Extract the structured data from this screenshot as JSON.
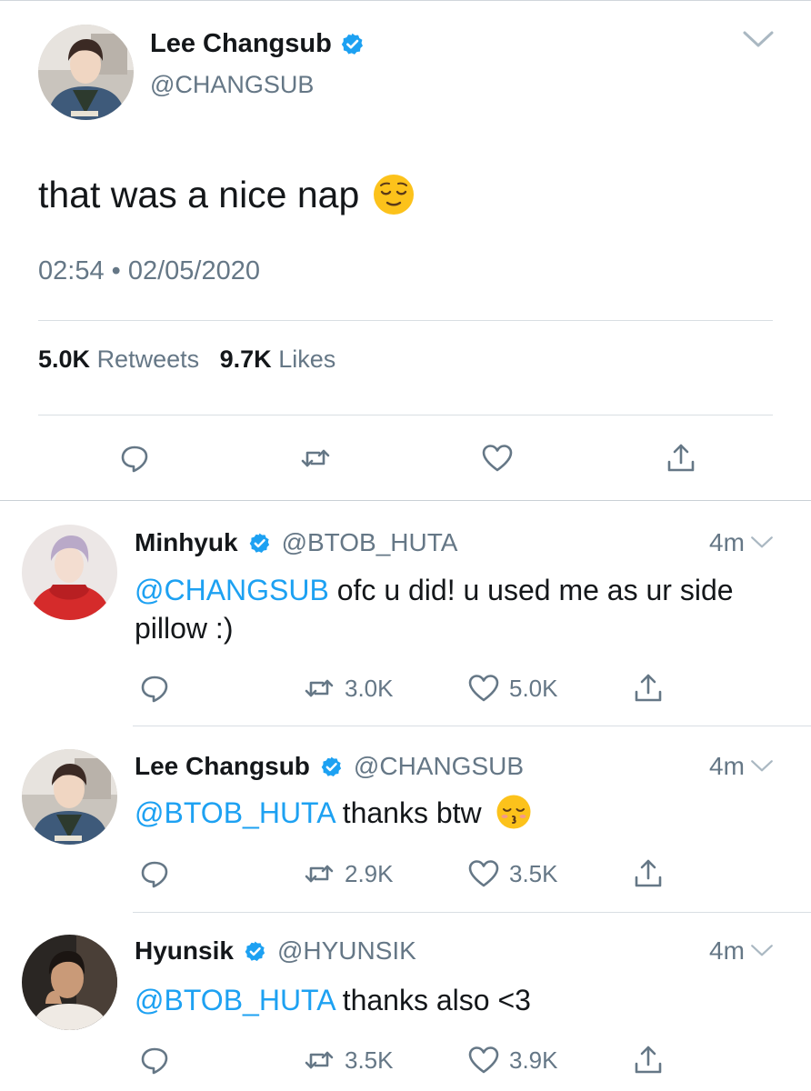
{
  "main_tweet": {
    "name": "Lee Changsub",
    "handle": "@CHANGSUB",
    "text": "that was a nice nap",
    "time": "02:54",
    "separator": "•",
    "date": "02/05/2020",
    "retweets_count": "5.0K",
    "retweets_label": "Retweets",
    "likes_count": "9.7K",
    "likes_label": "Likes",
    "emoji": "relieved-face"
  },
  "replies": [
    {
      "name": "Minhyuk",
      "handle": "@BTOB_HUTA",
      "age": "4m",
      "mention": "@CHANGSUB",
      "text_line1": "ofc u did! u used me as ur side",
      "text_line2": "pillow :)",
      "retweets": "3.0K",
      "likes": "5.0K"
    },
    {
      "name": "Lee Changsub",
      "handle": "@CHANGSUB",
      "age": "4m",
      "mention": "@BTOB_HUTA",
      "text": "thanks btw",
      "emoji": "kissing-face",
      "retweets": "2.9K",
      "likes": "3.5K"
    },
    {
      "name": "Hyunsik",
      "handle": "@HYUNSIK",
      "age": "4m",
      "mention": "@BTOB_HUTA",
      "text": "thanks also <3",
      "retweets": "3.5K",
      "likes": "3.9K"
    }
  ],
  "colors": {
    "link": "#1da1f2",
    "secondary_text": "#657786",
    "primary_text": "#14171a",
    "icon": "#657786"
  }
}
